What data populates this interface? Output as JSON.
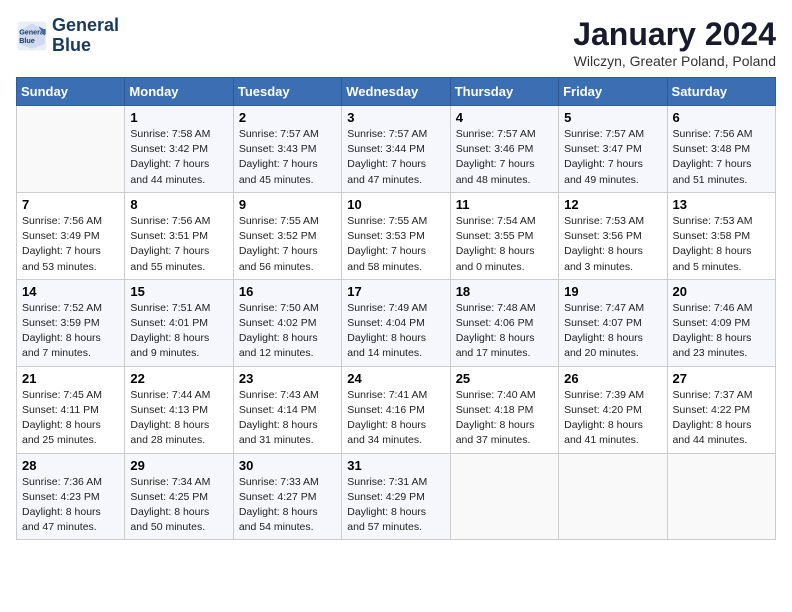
{
  "header": {
    "logo_line1": "General",
    "logo_line2": "Blue",
    "month_title": "January 2024",
    "location": "Wilczyn, Greater Poland, Poland"
  },
  "weekdays": [
    "Sunday",
    "Monday",
    "Tuesday",
    "Wednesday",
    "Thursday",
    "Friday",
    "Saturday"
  ],
  "weeks": [
    [
      {
        "day": "",
        "info": ""
      },
      {
        "day": "1",
        "info": "Sunrise: 7:58 AM\nSunset: 3:42 PM\nDaylight: 7 hours\nand 44 minutes."
      },
      {
        "day": "2",
        "info": "Sunrise: 7:57 AM\nSunset: 3:43 PM\nDaylight: 7 hours\nand 45 minutes."
      },
      {
        "day": "3",
        "info": "Sunrise: 7:57 AM\nSunset: 3:44 PM\nDaylight: 7 hours\nand 47 minutes."
      },
      {
        "day": "4",
        "info": "Sunrise: 7:57 AM\nSunset: 3:46 PM\nDaylight: 7 hours\nand 48 minutes."
      },
      {
        "day": "5",
        "info": "Sunrise: 7:57 AM\nSunset: 3:47 PM\nDaylight: 7 hours\nand 49 minutes."
      },
      {
        "day": "6",
        "info": "Sunrise: 7:56 AM\nSunset: 3:48 PM\nDaylight: 7 hours\nand 51 minutes."
      }
    ],
    [
      {
        "day": "7",
        "info": "Sunrise: 7:56 AM\nSunset: 3:49 PM\nDaylight: 7 hours\nand 53 minutes."
      },
      {
        "day": "8",
        "info": "Sunrise: 7:56 AM\nSunset: 3:51 PM\nDaylight: 7 hours\nand 55 minutes."
      },
      {
        "day": "9",
        "info": "Sunrise: 7:55 AM\nSunset: 3:52 PM\nDaylight: 7 hours\nand 56 minutes."
      },
      {
        "day": "10",
        "info": "Sunrise: 7:55 AM\nSunset: 3:53 PM\nDaylight: 7 hours\nand 58 minutes."
      },
      {
        "day": "11",
        "info": "Sunrise: 7:54 AM\nSunset: 3:55 PM\nDaylight: 8 hours\nand 0 minutes."
      },
      {
        "day": "12",
        "info": "Sunrise: 7:53 AM\nSunset: 3:56 PM\nDaylight: 8 hours\nand 3 minutes."
      },
      {
        "day": "13",
        "info": "Sunrise: 7:53 AM\nSunset: 3:58 PM\nDaylight: 8 hours\nand 5 minutes."
      }
    ],
    [
      {
        "day": "14",
        "info": "Sunrise: 7:52 AM\nSunset: 3:59 PM\nDaylight: 8 hours\nand 7 minutes."
      },
      {
        "day": "15",
        "info": "Sunrise: 7:51 AM\nSunset: 4:01 PM\nDaylight: 8 hours\nand 9 minutes."
      },
      {
        "day": "16",
        "info": "Sunrise: 7:50 AM\nSunset: 4:02 PM\nDaylight: 8 hours\nand 12 minutes."
      },
      {
        "day": "17",
        "info": "Sunrise: 7:49 AM\nSunset: 4:04 PM\nDaylight: 8 hours\nand 14 minutes."
      },
      {
        "day": "18",
        "info": "Sunrise: 7:48 AM\nSunset: 4:06 PM\nDaylight: 8 hours\nand 17 minutes."
      },
      {
        "day": "19",
        "info": "Sunrise: 7:47 AM\nSunset: 4:07 PM\nDaylight: 8 hours\nand 20 minutes."
      },
      {
        "day": "20",
        "info": "Sunrise: 7:46 AM\nSunset: 4:09 PM\nDaylight: 8 hours\nand 23 minutes."
      }
    ],
    [
      {
        "day": "21",
        "info": "Sunrise: 7:45 AM\nSunset: 4:11 PM\nDaylight: 8 hours\nand 25 minutes."
      },
      {
        "day": "22",
        "info": "Sunrise: 7:44 AM\nSunset: 4:13 PM\nDaylight: 8 hours\nand 28 minutes."
      },
      {
        "day": "23",
        "info": "Sunrise: 7:43 AM\nSunset: 4:14 PM\nDaylight: 8 hours\nand 31 minutes."
      },
      {
        "day": "24",
        "info": "Sunrise: 7:41 AM\nSunset: 4:16 PM\nDaylight: 8 hours\nand 34 minutes."
      },
      {
        "day": "25",
        "info": "Sunrise: 7:40 AM\nSunset: 4:18 PM\nDaylight: 8 hours\nand 37 minutes."
      },
      {
        "day": "26",
        "info": "Sunrise: 7:39 AM\nSunset: 4:20 PM\nDaylight: 8 hours\nand 41 minutes."
      },
      {
        "day": "27",
        "info": "Sunrise: 7:37 AM\nSunset: 4:22 PM\nDaylight: 8 hours\nand 44 minutes."
      }
    ],
    [
      {
        "day": "28",
        "info": "Sunrise: 7:36 AM\nSunset: 4:23 PM\nDaylight: 8 hours\nand 47 minutes."
      },
      {
        "day": "29",
        "info": "Sunrise: 7:34 AM\nSunset: 4:25 PM\nDaylight: 8 hours\nand 50 minutes."
      },
      {
        "day": "30",
        "info": "Sunrise: 7:33 AM\nSunset: 4:27 PM\nDaylight: 8 hours\nand 54 minutes."
      },
      {
        "day": "31",
        "info": "Sunrise: 7:31 AM\nSunset: 4:29 PM\nDaylight: 8 hours\nand 57 minutes."
      },
      {
        "day": "",
        "info": ""
      },
      {
        "day": "",
        "info": ""
      },
      {
        "day": "",
        "info": ""
      }
    ]
  ],
  "colors": {
    "header_bg": "#3c6eb4",
    "header_text": "#ffffff",
    "title_color": "#1a1a2e",
    "logo_color": "#1a3a5c"
  }
}
